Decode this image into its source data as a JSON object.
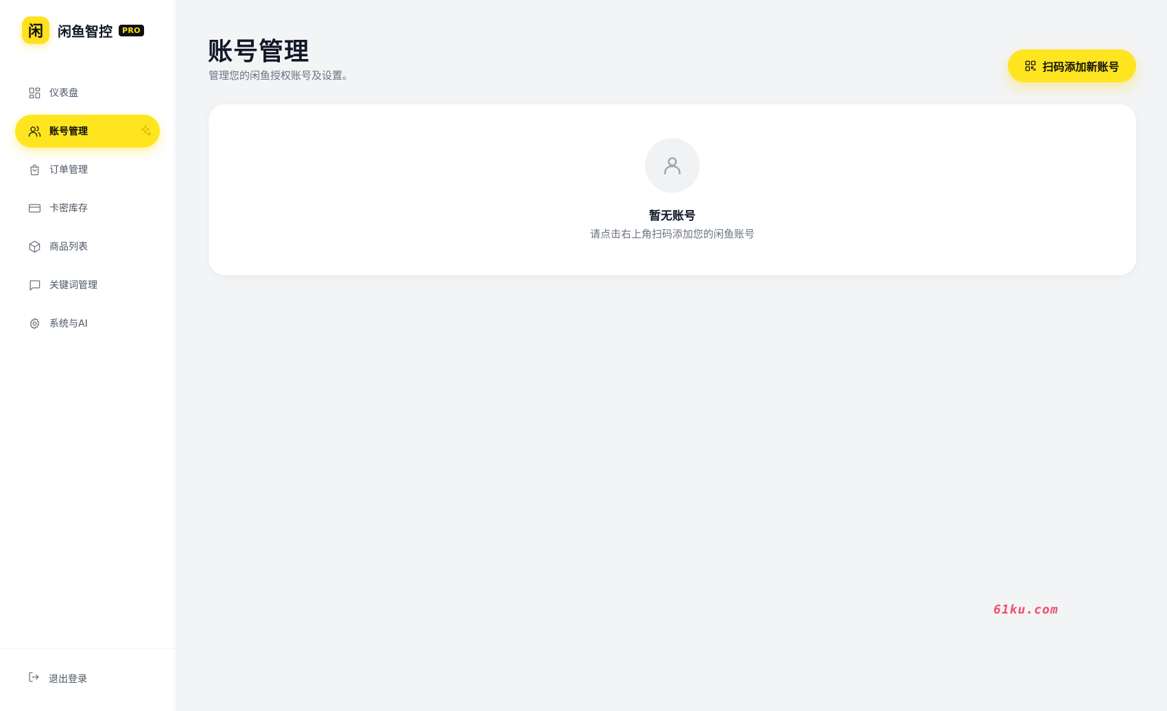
{
  "brand": {
    "logo_char": "闲",
    "name": "闲鱼智控",
    "badge": "PRO"
  },
  "sidebar": {
    "items": [
      {
        "label": "仪表盘",
        "icon": "dashboard-grid-icon",
        "active": false
      },
      {
        "label": "账号管理",
        "icon": "users-icon",
        "active": true
      },
      {
        "label": "订单管理",
        "icon": "shopping-bag-icon",
        "active": false
      },
      {
        "label": "卡密库存",
        "icon": "credit-card-icon",
        "active": false
      },
      {
        "label": "商品列表",
        "icon": "package-box-icon",
        "active": false
      },
      {
        "label": "关键词管理",
        "icon": "message-square-icon",
        "active": false
      },
      {
        "label": "系统与AI",
        "icon": "gear-icon",
        "active": false
      }
    ],
    "logout_label": "退出登录"
  },
  "header": {
    "title": "账号管理",
    "subtitle": "管理您的闲鱼授权账号及设置。",
    "add_button_label": "扫码添加新账号"
  },
  "empty_state": {
    "title": "暂无账号",
    "description": "请点击右上角扫码添加您的闲鱼账号"
  },
  "watermark": "61ku.com",
  "colors": {
    "accent": "#ffe51f",
    "background": "#f3f4f6",
    "text_primary": "#111827",
    "text_secondary": "#6b7280"
  }
}
